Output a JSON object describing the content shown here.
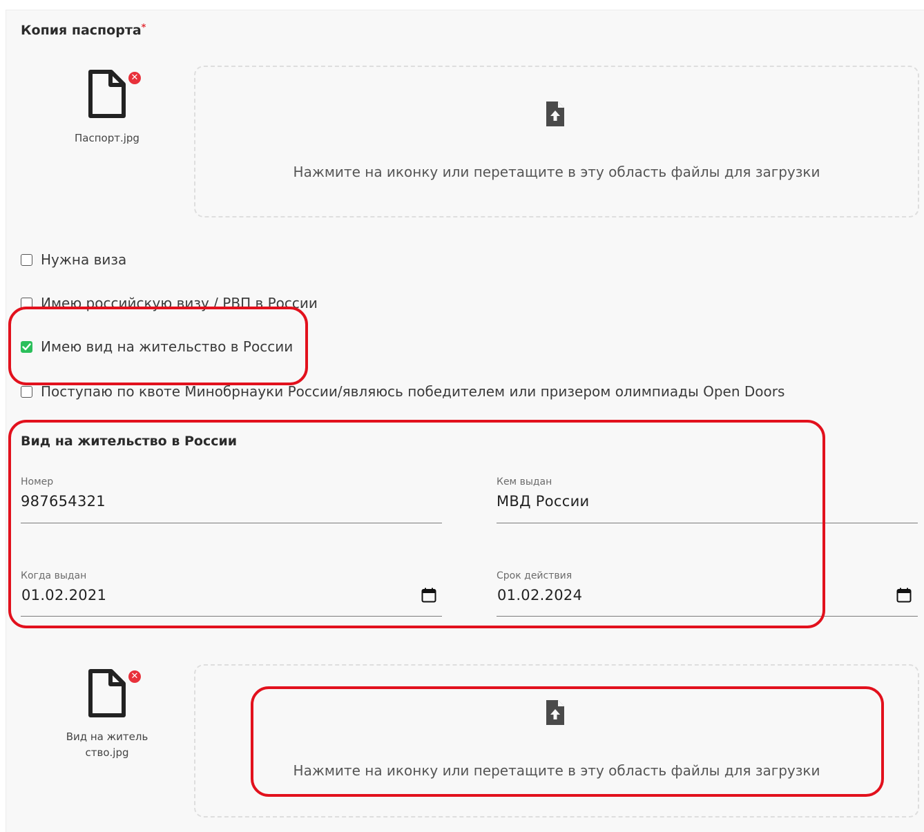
{
  "passport": {
    "title": "Копия паспорта",
    "required_mark": "*",
    "file_name": "Паспорт.jpg",
    "dropzone_text": "Нажмите на иконку или перетащите в эту область файлы для загрузки"
  },
  "checkboxes": [
    {
      "label": "Нужна виза",
      "checked": false
    },
    {
      "label": "Имею российскую визу / РВП в России",
      "checked": false
    },
    {
      "label": "Имею вид на жительство в России",
      "checked": true
    },
    {
      "label": "Поступаю по квоте Минобрнауки России/являюсь победителем или призером олимпиады Open Doors",
      "checked": false
    }
  ],
  "residence": {
    "title": "Вид на жительство в России",
    "number_label": "Номер",
    "number_value": "987654321",
    "issuer_label": "Кем выдан",
    "issuer_value": "МВД России",
    "issued_label": "Когда выдан",
    "issued_value": "01.02.2021",
    "expiry_label": "Срок действия",
    "expiry_value": "01.02.2024",
    "file_name_line1": "Вид на житель",
    "file_name_line2": "ство.jpg",
    "dropzone_text": "Нажмите на иконку или перетащите в эту область файлы для загрузки"
  },
  "colors": {
    "accent_red": "#e2111d",
    "checkbox_green": "#2bbf5b",
    "remove_red": "#e8313b"
  }
}
